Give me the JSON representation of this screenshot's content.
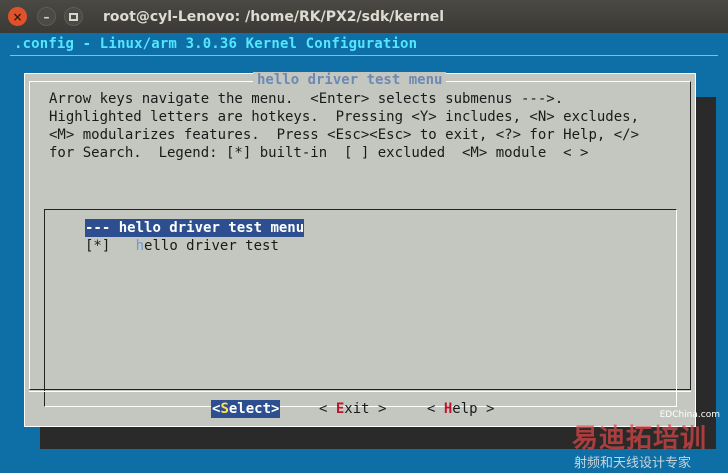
{
  "window": {
    "title": "root@cyl-Lenovo: /home/RK/PX2/sdk/kernel",
    "close_glyph": "×",
    "min_glyph": "–"
  },
  "terminal": {
    "header": ".config - Linux/arm 3.0.36 Kernel Configuration",
    "background_color": "#0d6fa6"
  },
  "dialog": {
    "title": "hello driver test menu",
    "help_lines": [
      "Arrow keys navigate the menu.  <Enter> selects submenus --->.",
      "Highlighted letters are hotkeys.  Pressing <Y> includes, <N> excludes,",
      "<M> modularizes features.  Press <Esc><Esc> to exit, <?> for Help, </>",
      "for Search.  Legend: [*] built-in  [ ] excluded  <M> module  < >"
    ],
    "menu": [
      {
        "prefix": "---",
        "label": "hello driver test menu",
        "selected": true
      },
      {
        "prefix": "[*]",
        "label_hot": "h",
        "label_rest": "ello driver test",
        "selected": false
      }
    ],
    "buttons": {
      "select": {
        "open": "<",
        "hot": "S",
        "rest": "elect",
        "close": ">"
      },
      "exit": {
        "open": "< ",
        "hot": "E",
        "rest": "xit",
        "close": " >"
      },
      "help": {
        "open": "< ",
        "hot": "H",
        "rest": "elp",
        "close": " >"
      }
    }
  },
  "watermark": {
    "brand": "易迪拓培训",
    "url": "EDChina.com",
    "tagline": "射频和天线设计专家"
  }
}
